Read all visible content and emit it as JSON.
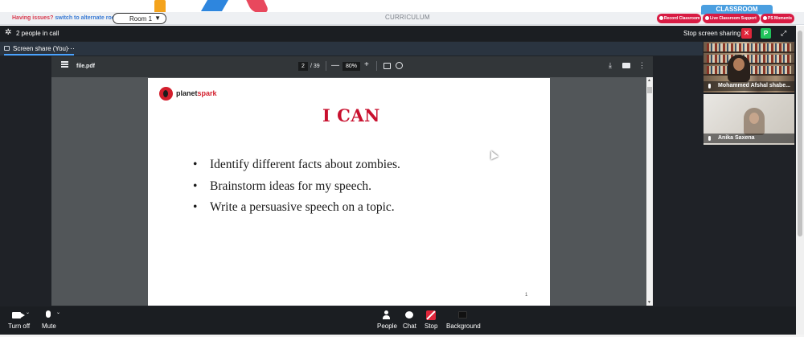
{
  "topbar": {
    "issues_text": "Having issues?",
    "switch_link": "switch to alternate room",
    "room": "Room 1",
    "room_caret": "▼",
    "curriculum": "CURRICULUM",
    "classroom_tab": "CLASSROOM",
    "record_btn": "Record Classroom",
    "support_btn": "Live Classroom Support",
    "moments_btn": "PS Moments"
  },
  "call": {
    "people_in_call": "2 people in call",
    "stop_sharing": "Stop screen sharing",
    "close_glyph": "✕",
    "profile_initial": "P",
    "fullscreen_glyph": "⤢",
    "share_tab": "Screen share (You)",
    "more_glyph": "···"
  },
  "pdf": {
    "filename": "file.pdf",
    "page_current": "2",
    "page_total": "/ 39",
    "zoom": "80%",
    "zoom_out": "—",
    "zoom_in": "+",
    "download_glyph": "⤓",
    "more_glyph": "⋮",
    "page_marker": "1"
  },
  "slide": {
    "logo_word1": "planet",
    "logo_word2": "spark",
    "title": "I CAN",
    "bullet_glyph": "•",
    "bullets": [
      "Identify different facts about zombies.",
      "Brainstorm ideas for my speech.",
      "Write a persuasive speech on a topic."
    ]
  },
  "participants": [
    {
      "name": "Mohammed Afshal shabe..."
    },
    {
      "name": "Anika Saxena"
    }
  ],
  "controls": {
    "turn_off": "Turn off",
    "mute": "Mute",
    "people": "People",
    "chat": "Chat",
    "stop": "Stop",
    "background": "Background",
    "chevron": "⌄"
  },
  "colors": {
    "accent_red": "#d81b43",
    "slide_title": "#c8102e",
    "share_underline": "#4aa3ff",
    "classroom_tab": "#4b9fe0"
  }
}
